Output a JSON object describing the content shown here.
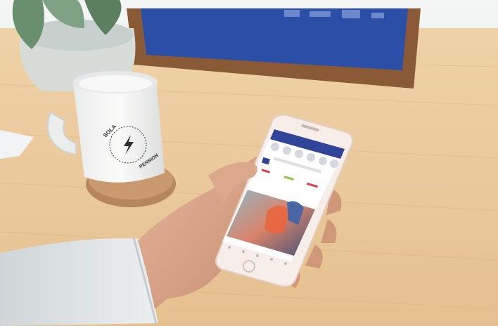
{
  "image": {
    "alt": "",
    "subjects": [
      "coffee-mug",
      "smartphone",
      "hand",
      "potted-plant",
      "picture-frame",
      "cork-coaster"
    ]
  },
  "mug": {
    "print_text_top": "SOLA",
    "print_text_bottom": "PENSION",
    "print_icon": "lightning-bolt-icon"
  },
  "phone": {
    "screen_app": "social-feed",
    "home_button": true
  },
  "colors": {
    "desk_wood": "#e9c79a",
    "wall": "#eef0f0",
    "frame_wood": "#8a5a36",
    "frame_art_blue": "#2b4ea6",
    "phone_body": "#f7eee9",
    "phone_header_blue": "#30449a",
    "sleeve_gray": "#dfe4e6",
    "skin": "#d9a487",
    "cork": "#b6865c"
  }
}
